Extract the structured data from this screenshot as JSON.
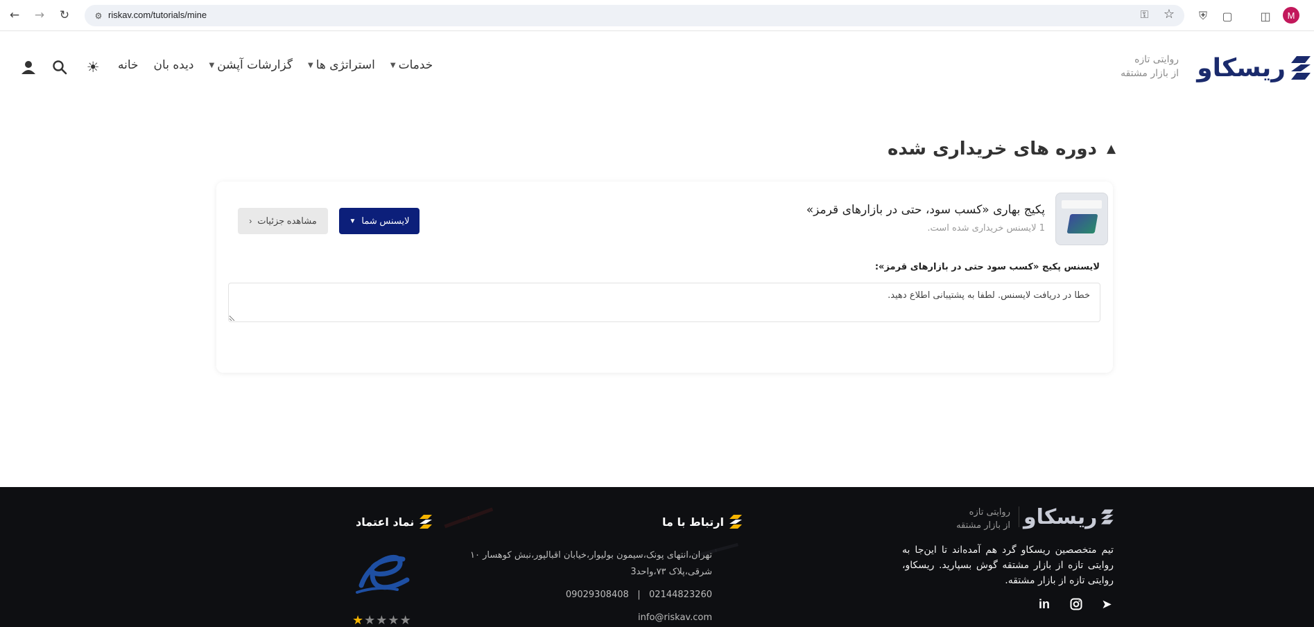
{
  "browser": {
    "url": "riskav.com/tutorials/mine",
    "profile_initial": "M"
  },
  "header": {
    "logo_text": "ریسکاو",
    "tagline_line1": "روایتی تازه",
    "tagline_line2": "از بازار مشتقه",
    "nav": [
      {
        "label": "خانه",
        "has_dropdown": false
      },
      {
        "label": "دیده بان",
        "has_dropdown": false
      },
      {
        "label": "گزارشات آپشن",
        "has_dropdown": true
      },
      {
        "label": "استراتژی ها",
        "has_dropdown": true
      },
      {
        "label": "خدمات",
        "has_dropdown": true
      }
    ],
    "icons": [
      "theme-toggle-icon",
      "search-icon",
      "user-icon"
    ]
  },
  "page": {
    "title": "دوره های خریداری شده"
  },
  "course": {
    "title": "پکیج بهاری «کسب سود، حتی در بازارهای قرمز»",
    "subtitle": "1 لایسنس خریداری شده است.",
    "license_button": "لایسنس شما",
    "details_button": "مشاهده جزئیات",
    "license_label": "لایسنس پکیج «کسب سود حتی در بازارهای قرمز»:",
    "license_value": "خطا در دریافت لایسنس. لطفا به پشتیبانی اطلاع دهید."
  },
  "footer": {
    "logo_text": "ریسکاو",
    "tagline_line1": "روایتی تازه",
    "tagline_line2": "از بازار مشتقه",
    "about": "تیم متخصصین ریسکاو گرد هم آمده‌اند تا این‌جا به روایتی تازه از بازار مشتقه گوش بسپارید. ریسکاو، روایتی تازه از بازار مشتقه.",
    "contact_heading": "ارتباط با ما",
    "address": "تهران،انتهای پونک،سیمون بولیوار،خیابان اقبالپور،نبش کوهسار ۱۰ شرقی،پلاک ۷۳،واحد3",
    "phone1": "02144823260",
    "phone2": "09029308408",
    "phone_separator": "|",
    "email": "info@riskav.com",
    "trust_heading": "نماد اعتماد",
    "rating": 1,
    "rating_max": 5
  }
}
